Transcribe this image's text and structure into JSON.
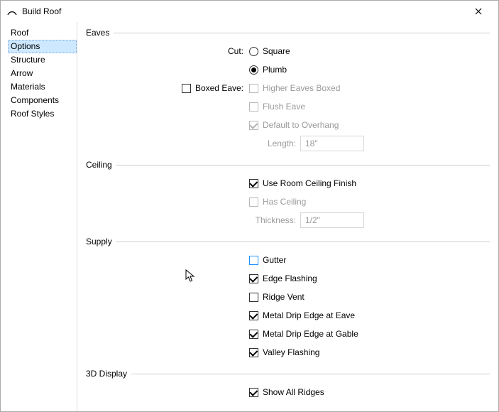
{
  "window": {
    "title": "Build Roof"
  },
  "sidebar": {
    "items": [
      {
        "label": "Roof"
      },
      {
        "label": "Options"
      },
      {
        "label": "Structure"
      },
      {
        "label": "Arrow"
      },
      {
        "label": "Materials"
      },
      {
        "label": "Components"
      },
      {
        "label": "Roof Styles"
      }
    ],
    "selectedIndex": 1
  },
  "eaves": {
    "section": "Eaves",
    "cut_label": "Cut:",
    "square": "Square",
    "plumb": "Plumb",
    "boxed_eave": "Boxed Eave:",
    "higher_boxed": "Higher Eaves Boxed",
    "flush_eave": "Flush Eave",
    "default_overhang": "Default to Overhang",
    "length_label": "Length:",
    "length_value": "18\""
  },
  "ceiling": {
    "section": "Ceiling",
    "use_room_finish": "Use Room Ceiling Finish",
    "has_ceiling": "Has Ceiling",
    "thickness_label": "Thickness:",
    "thickness_value": "1/2\""
  },
  "supply": {
    "section": "Supply",
    "gutter": "Gutter",
    "edge_flashing": "Edge Flashing",
    "ridge_vent": "Ridge Vent",
    "drip_eave": "Metal Drip Edge at Eave",
    "drip_gable": "Metal Drip Edge at Gable",
    "valley_flashing": "Valley Flashing"
  },
  "display3d": {
    "section": "3D Display",
    "show_all_ridges": "Show All Ridges"
  }
}
